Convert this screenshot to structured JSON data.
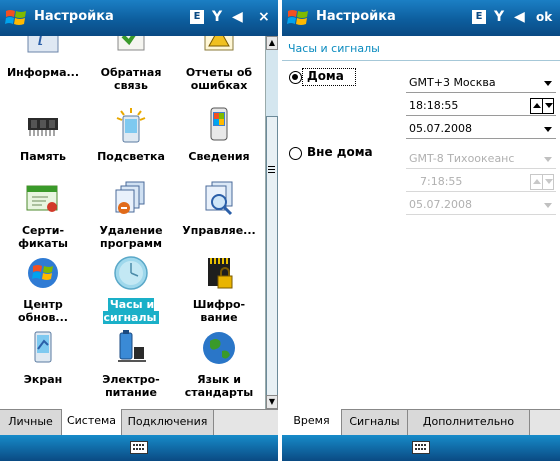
{
  "left": {
    "title": "Настройка",
    "status": {
      "network_badge": "E",
      "signal_glyph": "Y",
      "volume_glyph": "◀",
      "action": "×"
    },
    "items": [
      {
        "label": "Информа...",
        "icon": "info-icon"
      },
      {
        "label": "Обратная\nсвязь",
        "icon": "feedback-icon"
      },
      {
        "label": "Отчеты об\nошибках",
        "icon": "error-report-icon"
      },
      {
        "label": "Память",
        "icon": "memory-icon"
      },
      {
        "label": "Подсветка",
        "icon": "backlight-icon"
      },
      {
        "label": "Сведения",
        "icon": "about-icon"
      },
      {
        "label": "Серти-\nфикаты",
        "icon": "certificates-icon"
      },
      {
        "label": "Удаление\nпрограмм",
        "icon": "remove-programs-icon"
      },
      {
        "label": "Управляе...",
        "icon": "managed-programs-icon"
      },
      {
        "label": "Центр\nобнов...",
        "icon": "update-center-icon"
      },
      {
        "label": "Часы и\nсигналы",
        "icon": "clock-icon"
      },
      {
        "label": "Шифро-\nвание",
        "icon": "encryption-icon"
      },
      {
        "label": "Экран",
        "icon": "screen-icon"
      },
      {
        "label": "Электро-\nпитание",
        "icon": "power-icon"
      },
      {
        "label": "Язык и\nстандарты",
        "icon": "globe-icon"
      }
    ],
    "tabs": [
      "Личные",
      "Система",
      "Подключения"
    ],
    "active_tab": "Система",
    "selected_item": "Часы и сигналы"
  },
  "right": {
    "title": "Настройка",
    "status": {
      "network_badge": "E",
      "signal_glyph": "Y",
      "volume_glyph": "◀",
      "action": "ok"
    },
    "section_title": "Часы и сигналы",
    "home": {
      "label": "Дома",
      "selected": true,
      "timezone": "GMT+3 Москва",
      "time": "18:18:55",
      "date": "05.07.2008"
    },
    "visiting": {
      "label": "Вне дома",
      "selected": false,
      "timezone": "GMT-8 Тихоокеанс",
      "time": "7:18:55",
      "date": "05.07.2008"
    },
    "tabs": [
      "Время",
      "Сигналы",
      "Дополнительно"
    ],
    "active_tab": "Время"
  },
  "colors": {
    "titlebar_top": "#1b7fc4",
    "titlebar_bottom": "#0a4a83",
    "selection": "#1ab0c8",
    "section_title": "#0a8bbf"
  }
}
